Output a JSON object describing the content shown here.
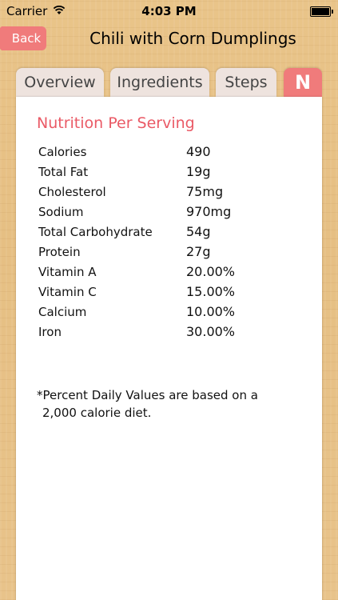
{
  "status_bar": {
    "carrier": "Carrier",
    "time": "4:03 PM"
  },
  "nav": {
    "back_label": "Back",
    "title": "Chili with Corn Dumplings"
  },
  "tabs": [
    {
      "label": "Overview"
    },
    {
      "label": "Ingredients"
    },
    {
      "label": "Steps"
    },
    {
      "label": "N"
    }
  ],
  "nutrition": {
    "title": "Nutrition Per Serving",
    "rows": [
      {
        "label": "Calories",
        "value": "490"
      },
      {
        "label": "Total Fat",
        "value": "19g"
      },
      {
        "label": "Cholesterol",
        "value": "75mg"
      },
      {
        "label": "Sodium",
        "value": "970mg"
      },
      {
        "label": "Total Carbohydrate",
        "value": "54g"
      },
      {
        "label": "Protein",
        "value": "27g"
      },
      {
        "label": "Vitamin A",
        "value": "20.00%"
      },
      {
        "label": "Vitamin C",
        "value": "15.00%"
      },
      {
        "label": "Calcium",
        "value": "10.00%"
      },
      {
        "label": "Iron",
        "value": "30.00%"
      }
    ],
    "footnote_line1": "*Percent Daily Values are based on a",
    "footnote_line2": "2,000 calorie diet."
  },
  "colors": {
    "accent": "#f07b7b",
    "title_red": "#ea5a66",
    "wood": "#e8c38a"
  }
}
